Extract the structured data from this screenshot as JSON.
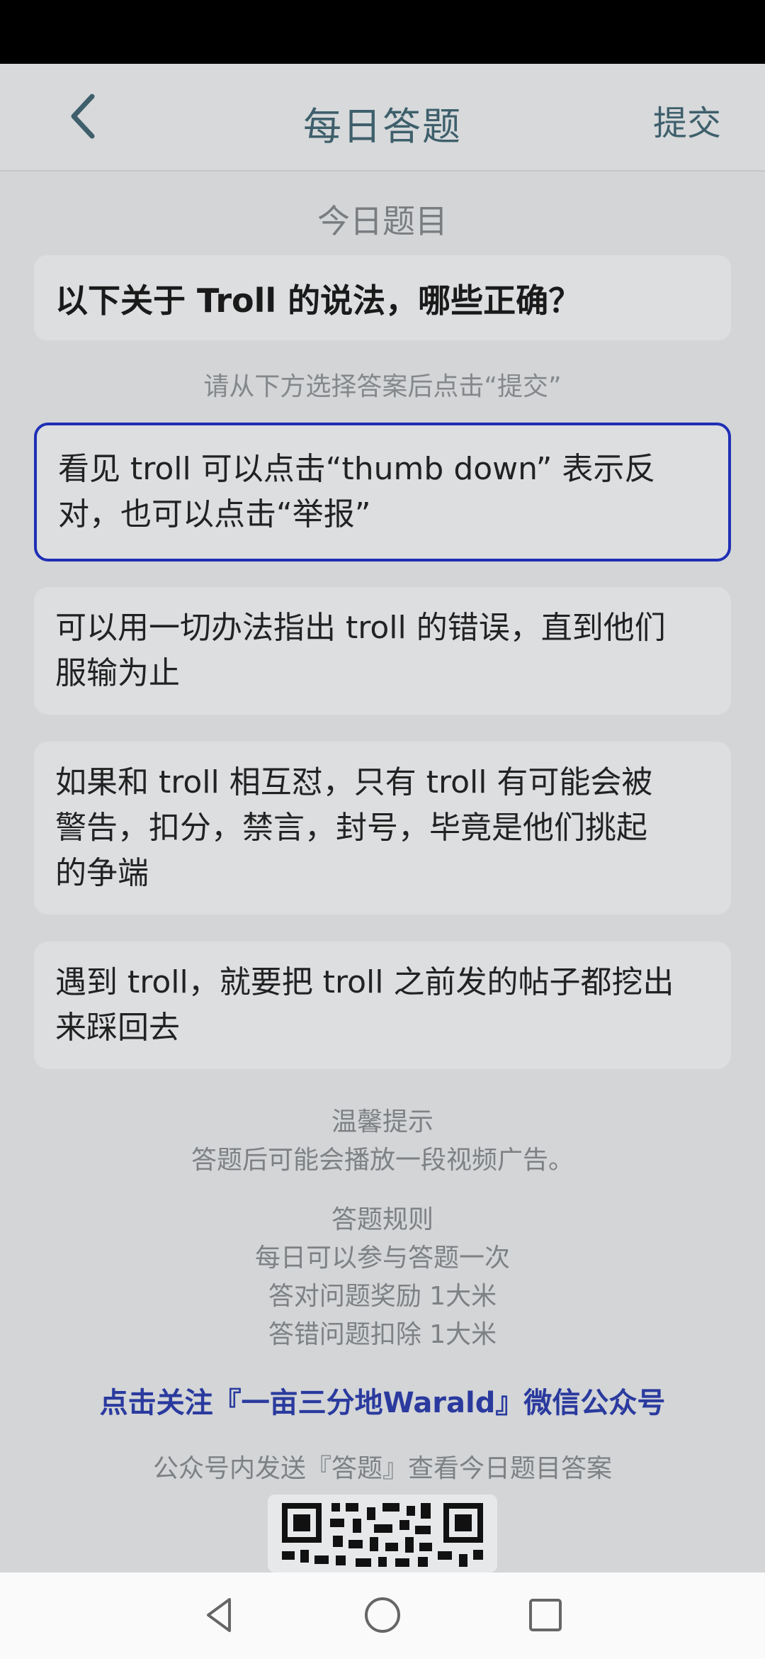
{
  "header": {
    "title": "每日答题",
    "submit_label": "提交",
    "back_icon": "chevron-left-icon"
  },
  "question": {
    "section_label": "今日题目",
    "text": "以下关于 Troll 的说法，哪些正确？",
    "instruction": "请从下方选择答案后点击“提交”"
  },
  "options": [
    {
      "lines": [
        "看见 troll 可以点击“thumb down” 表示反",
        "对，也可以点击“举报”"
      ],
      "selected": true
    },
    {
      "lines": [
        "可以用一切办法指出 troll 的错误，直到他们",
        "服输为止"
      ],
      "selected": false
    },
    {
      "lines": [
        "如果和 troll 相互怼，只有 troll 有可能会被",
        "警告，扣分，禁言，封号，毕竟是他们挑起",
        "的争端"
      ],
      "selected": false
    },
    {
      "lines": [
        "遇到 troll，就要把 troll 之前发的帖子都挖出",
        "来踩回去"
      ],
      "selected": false
    }
  ],
  "tips": {
    "title": "温馨提示",
    "text": "答题后可能会播放一段视频广告。"
  },
  "rules": {
    "title": "答题规则",
    "items": [
      "每日可以参与答题一次",
      "答对问题奖励 1大米",
      "答错问题扣除 1大米"
    ]
  },
  "follow_link": "点击关注『一亩三分地Warald』微信公众号",
  "send_hint": "公众号内发送『答题』查看今日题目答案",
  "nav": {
    "back": "back-triangle-icon",
    "home": "home-circle-icon",
    "recents": "recents-square-icon"
  },
  "colors": {
    "accent": "#3e5f6b",
    "selected_border": "#1f2fb5",
    "link": "#2a3a9e"
  }
}
